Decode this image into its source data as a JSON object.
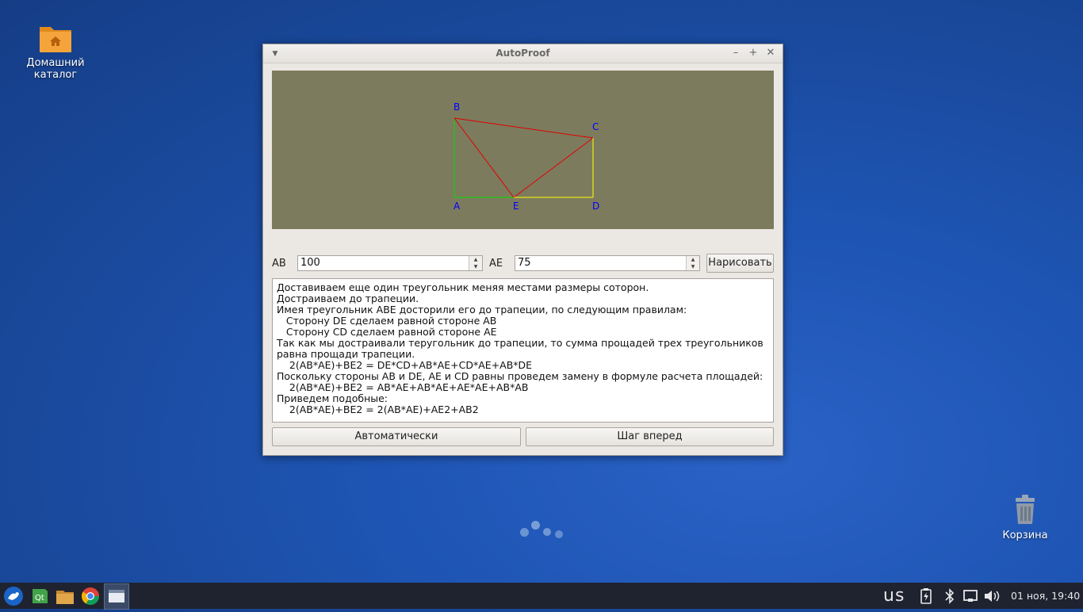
{
  "desktop": {
    "home_label_1": "Домашний",
    "home_label_2": "каталог",
    "trash_label": "Корзина"
  },
  "window": {
    "title": "AutoProof",
    "menu_icon": "chevron-down-icon",
    "minimize_icon": "minimize-icon",
    "maximize_icon": "maximize-icon",
    "close_icon": "close-icon"
  },
  "diagram": {
    "points": [
      {
        "name": "A"
      },
      {
        "name": "B"
      },
      {
        "name": "C"
      },
      {
        "name": "D"
      },
      {
        "name": "E"
      }
    ],
    "colors": {
      "background": "#7d7b5d",
      "label": "#0000ff",
      "abe_legs": "#00e000",
      "hypotenuses": "#e00000",
      "ecd_legs": "#ffff00"
    }
  },
  "controls": {
    "ab_label": "AB",
    "ab_value": "100",
    "ae_label": "AE",
    "ae_value": "75",
    "draw_button": "Нарисовать",
    "auto_button": "Автоматически",
    "step_button": "Шаг вперед"
  },
  "log": {
    "lines": [
      "Доставиваем еще один треугольник меняя местами размеры сотoрон.",
      "Достраиваем до трапеции.",
      "Имея треугольник ABE досторили его до трапеции, по следующим правилам:",
      "   Сторону DE сделаем равной стороне AB",
      "   Сторону CD сделаем равной стороне AE",
      "Так как мы достраивали теругольник до трапеции, то сумма прощадей трех треугольников",
      "равна прощади трапеции.",
      "    2(AB*AE)+BE2 = DE*CD+AB*AE+CD*AE+AB*DE",
      "Поскольку стороны AB и DE, AE и CD равны проведем замену в формуле расчета площадей:",
      "    2(AB*AE)+BE2 = AB*AE+AB*AE+AE*AE+AB*AB",
      "Приведем подобные:",
      "    2(AB*AE)+BE2 = 2(AB*AE)+AE2+AB2"
    ]
  },
  "taskbar": {
    "keyboard_layout": "us",
    "clock": "01 ноя, 19:40",
    "apps": [
      "xfce-menu-icon",
      "qt-creator-icon",
      "file-manager-icon",
      "chrome-icon",
      "window-icon"
    ],
    "tray_icons": [
      "battery-icon",
      "bluetooth-icon",
      "network-icon",
      "volume-icon"
    ]
  }
}
